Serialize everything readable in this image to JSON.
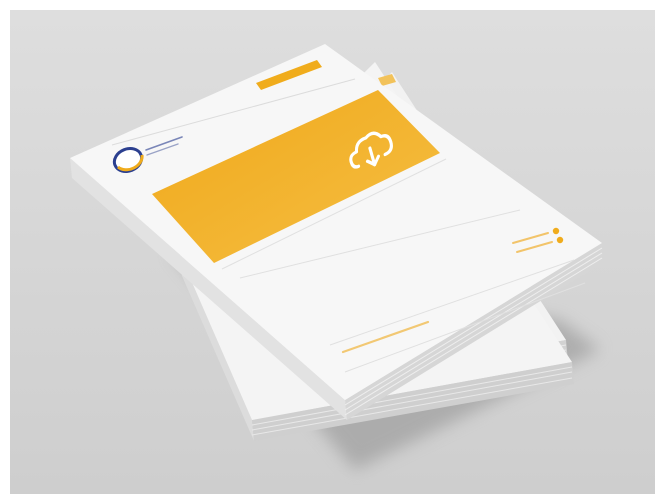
{
  "scene": {
    "description_free": true,
    "colors": {
      "backdrop_top": "#d9d9d9",
      "backdrop_bottom": "#cfcfcf",
      "paper": "#f6f6f6",
      "paper_edge": "#e4e4e4",
      "accent": "#f0ac1c",
      "accent_light": "#f5c14a",
      "rule": "#dcdcdc",
      "logo_blue": "#2b3f8f",
      "shadow": "#9a9a9a"
    },
    "icons": {
      "hero": "cloud-download-icon",
      "logo": "circle-logo-icon",
      "contact_1": "globe-icon",
      "contact_2": "phone-icon"
    },
    "stack": {
      "sheet_count": 3
    }
  }
}
